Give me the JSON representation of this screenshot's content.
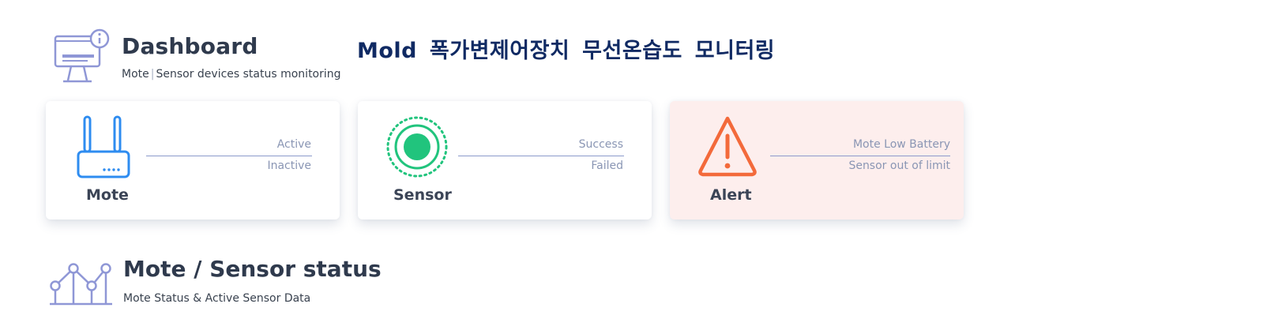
{
  "header": {
    "title": "Dashboard",
    "subtitle_left": "Mote",
    "subtitle_sep": "|",
    "subtitle_right": "Sensor devices status monitoring",
    "icon": "presentation-board-icon"
  },
  "main_title": "Mold 폭가변제어장치 무선온습도 모니터링",
  "cards": [
    {
      "label": "Mote",
      "icon": "router-icon",
      "stat_top": "Active",
      "stat_bottom": "Inactive",
      "accent": "#2e8cf0"
    },
    {
      "label": "Sensor",
      "icon": "sensor-dot-icon",
      "stat_top": "Success",
      "stat_bottom": "Failed",
      "accent": "#21c47d"
    },
    {
      "label": "Alert",
      "icon": "warning-triangle-icon",
      "stat_top": "Mote Low Battery",
      "stat_bottom": "Sensor out of limit",
      "accent": "#f36a3b",
      "background": "#fdeeed"
    }
  ],
  "status_section": {
    "title": "Mote / Sensor status",
    "subtitle": "Mote Status & Active Sensor Data",
    "icon": "line-chart-icon"
  },
  "colors": {
    "icon_outline": "#8f97d6",
    "title_navy": "#102a63",
    "divider": "#8c9acb"
  }
}
